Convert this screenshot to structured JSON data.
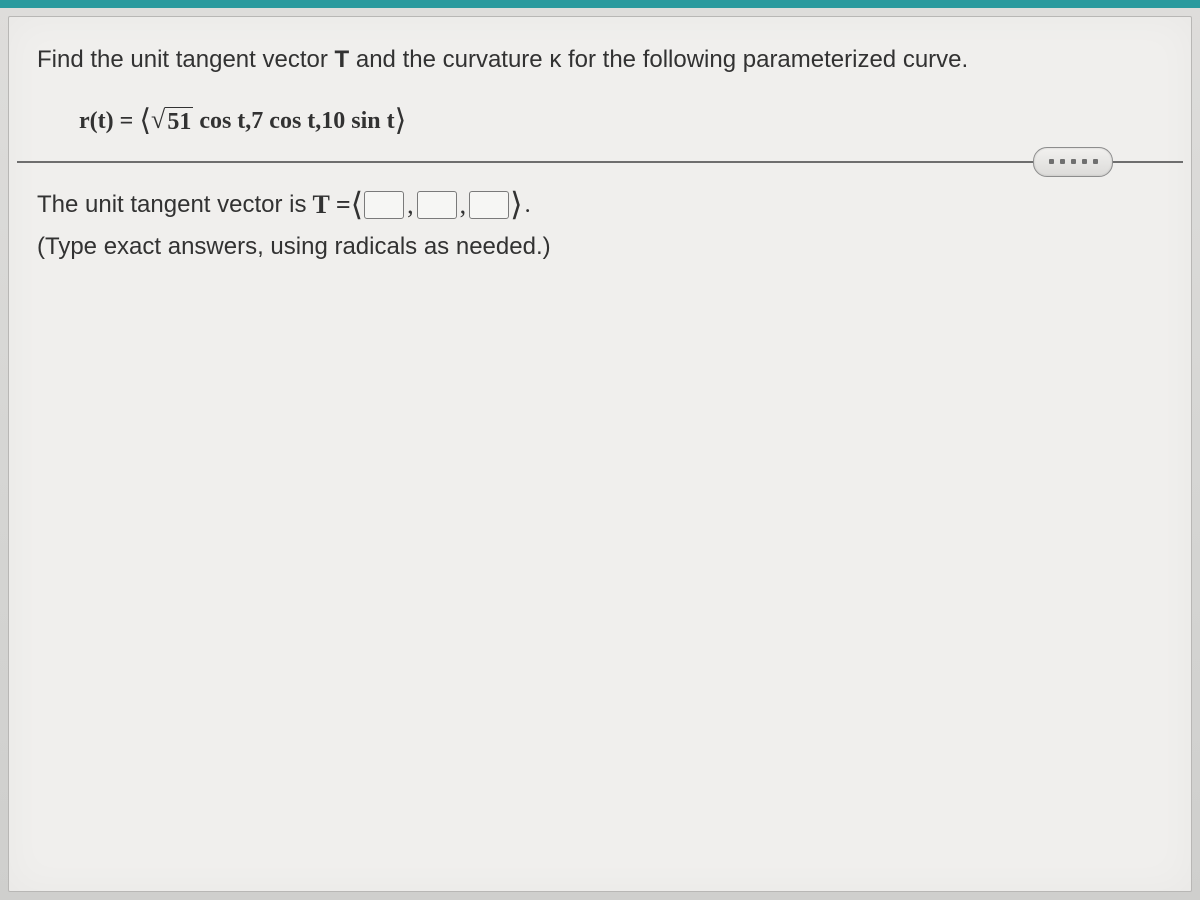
{
  "question": {
    "prompt_pre": "Find the unit tangent vector ",
    "T_sym": "T",
    "mid1": " and the curvature ",
    "kappa": "κ",
    "mid2": " for the following parameterized curve."
  },
  "equation": {
    "lhs": "r(t) = ",
    "angle_l": "⟨",
    "sqrt_arg": "51",
    "term1_after": " cos t,",
    "term2": "7 cos t,",
    "term3": "10 sin t",
    "angle_r": "⟩"
  },
  "answer": {
    "lead": "The unit tangent vector is ",
    "T_eq": "T = ",
    "paren_l": "⟨",
    "comma": ",",
    "paren_r": "⟩",
    "period": ".",
    "hint": "(Type exact answers, using radicals as needed.)"
  }
}
